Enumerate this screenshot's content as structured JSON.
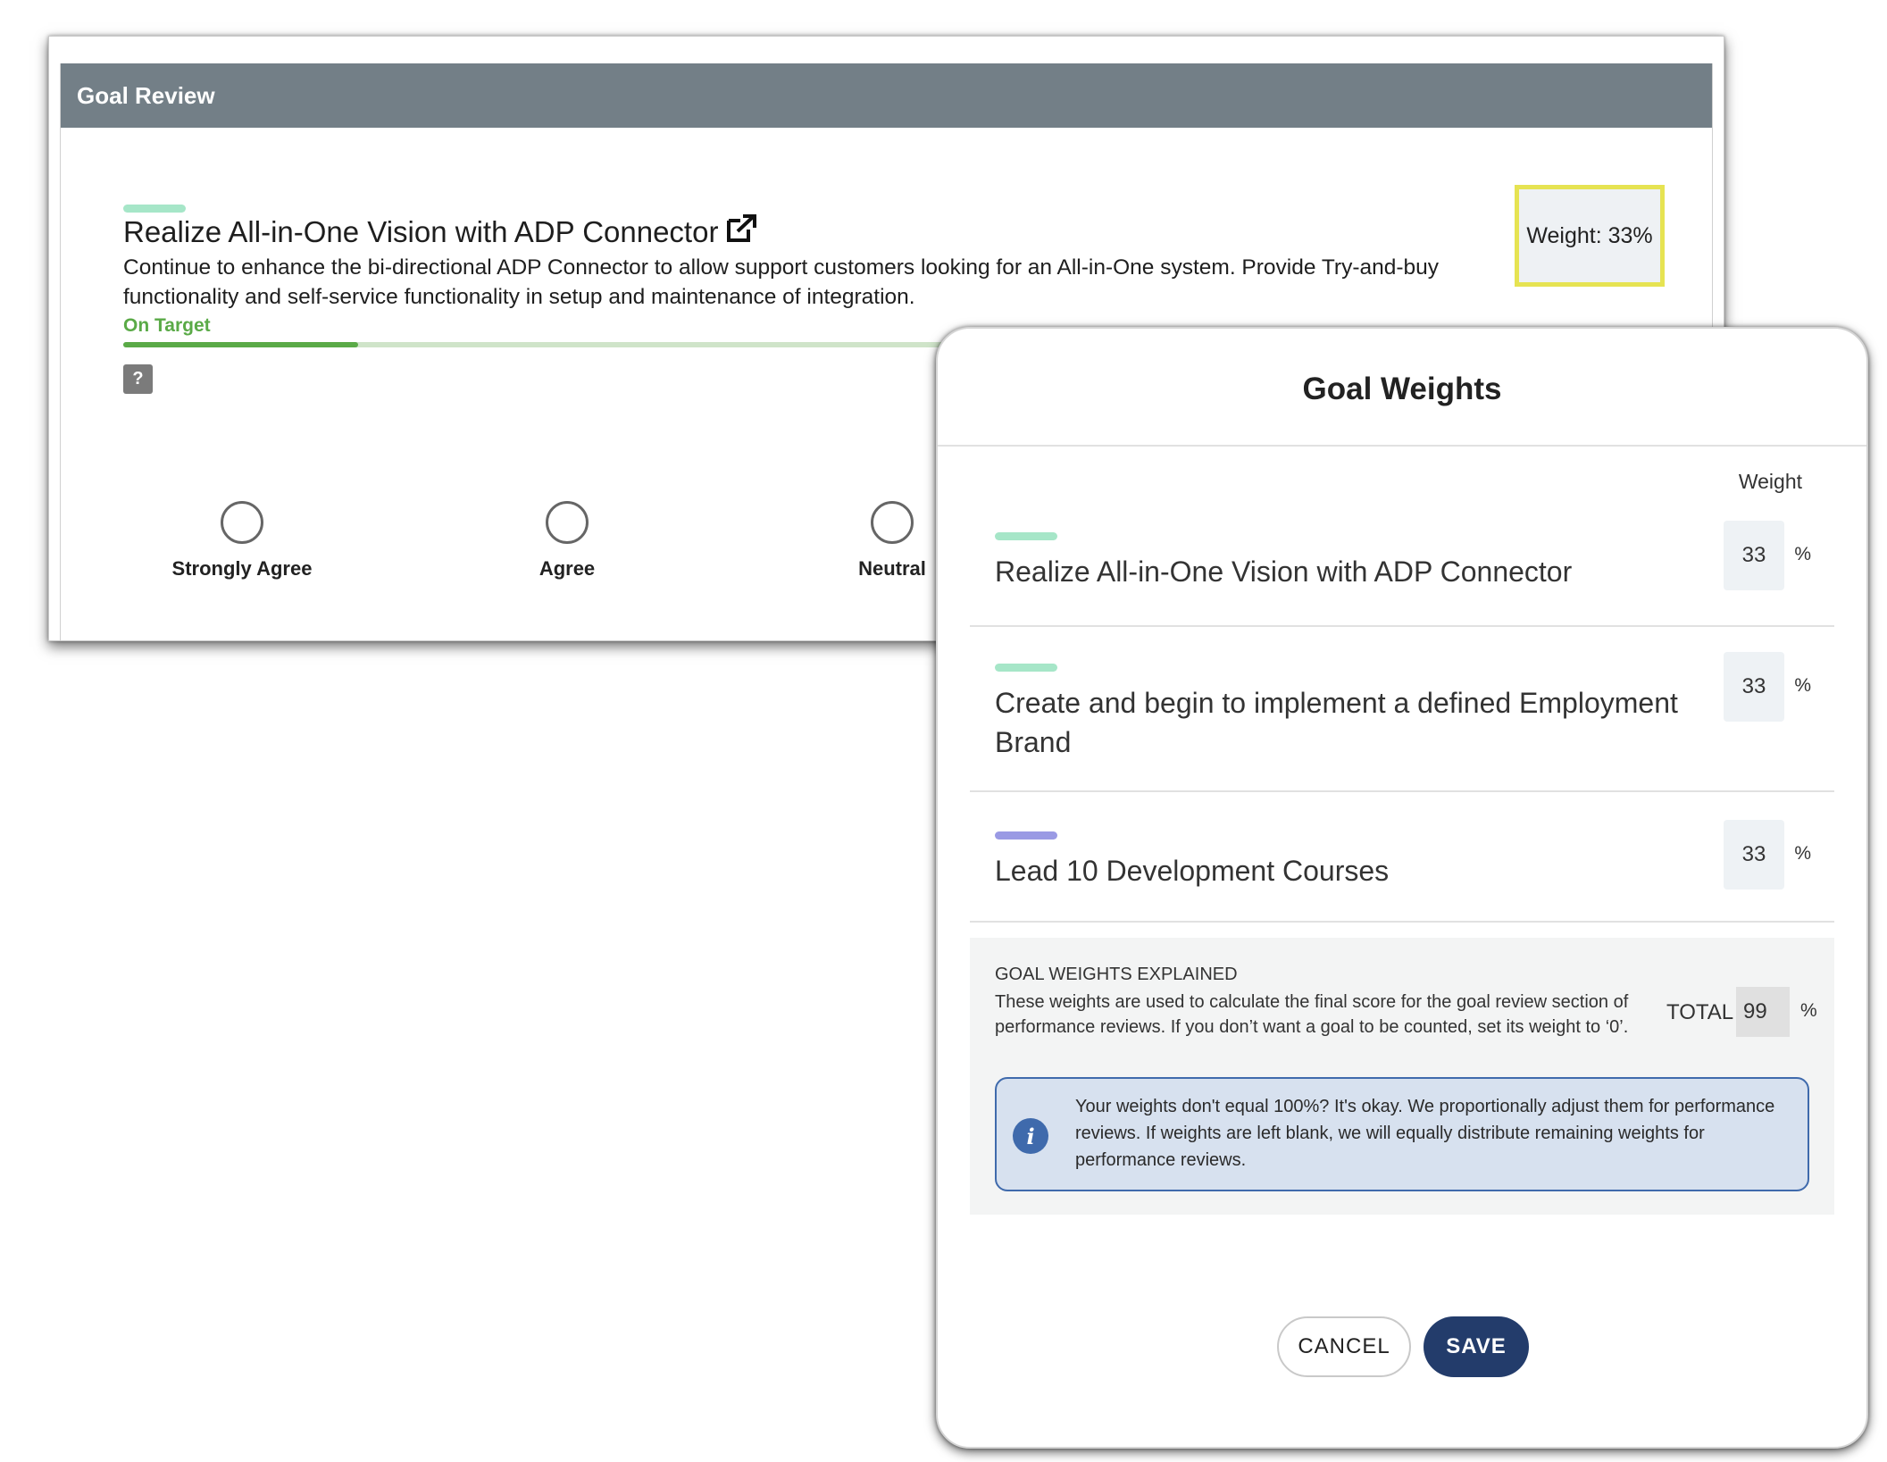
{
  "review": {
    "header_title": "Goal Review",
    "goal_title": "Realize All-in-One Vision with ADP Connector",
    "goal_description": "Continue to enhance the bi-directional ADP Connector to allow support customers looking for an All-in-One system. Provide Try-and-buy functionality and self-service functionality in setup and maintenance of integration.",
    "status": "On Target",
    "progress_fraction": 0.263,
    "help_label": "?",
    "weight_label": "Weight: 33%",
    "rating_options": [
      "Strongly Agree",
      "Agree",
      "Neutral"
    ],
    "icons": {
      "external_link": "external-link-icon"
    },
    "colors": {
      "header": "#737f87",
      "status": "#5aaa47",
      "highlight": "#e6e352"
    }
  },
  "modal": {
    "title": "Goal Weights",
    "weight_column_header": "Weight",
    "goals": [
      {
        "title": "Realize All-in-One Vision with ADP Connector",
        "weight": "33",
        "unit": "%",
        "chip_color": "#a6e6c8"
      },
      {
        "title": "Create and begin to implement a defined Employment Brand",
        "weight": "33",
        "unit": "%",
        "chip_color": "#a6e6c8"
      },
      {
        "title": "Lead 10 Development Courses",
        "weight": "33",
        "unit": "%",
        "chip_color": "#9a9ae4"
      }
    ],
    "explained": {
      "heading": "GOAL WEIGHTS EXPLAINED",
      "text": "These weights are used to calculate the final score for the goal review section of performance reviews. If you don’t want a goal to be counted, set its weight to ‘0’.",
      "total_label": "TOTAL",
      "total_value": "99",
      "total_unit": "%"
    },
    "info": {
      "icon": "info-icon",
      "text": "Your weights don't equal 100%? It's okay. We proportionally adjust them for performance reviews. If weights are left blank, we will equally distribute remaining weights for performance reviews."
    },
    "buttons": {
      "cancel": "CANCEL",
      "save": "SAVE"
    },
    "colors": {
      "save_button": "#233c6b",
      "info_border": "#3f6aac",
      "info_bg": "#d7e1ef"
    }
  }
}
